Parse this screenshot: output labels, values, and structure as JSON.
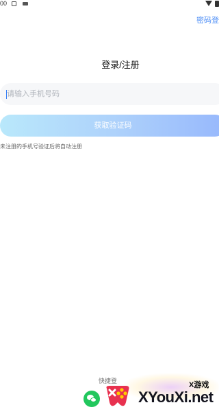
{
  "status_bar": {
    "time": "00",
    "icons": [
      "notification-icon",
      "gallery-icon",
      "wifi-icon",
      "battery-icon"
    ]
  },
  "header": {
    "password_login_label": "密码登"
  },
  "main": {
    "title": "登录/注册",
    "phone_input": {
      "placeholder": "请输入手机号码",
      "value": ""
    },
    "get_code_label": "获取验证码",
    "register_note": "未注册的手机号验证后将自动注册"
  },
  "footer": {
    "quick_login_label": "快捷登",
    "quick_login_icons": [
      "wechat-icon"
    ]
  },
  "watermark": {
    "title": "X游戏",
    "domain": "XYouXi.net"
  },
  "colors": {
    "accent": "#4c8df6",
    "button_gradient_start": "#b9e8fb",
    "button_gradient_end": "#97b8fc",
    "wechat": "#21c75d",
    "input_background": "#f6f7f9"
  }
}
